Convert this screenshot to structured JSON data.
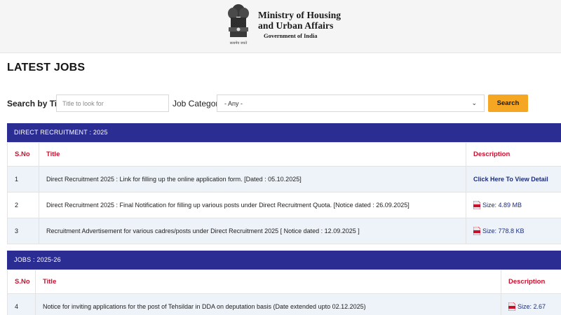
{
  "header": {
    "ministry_line1": "Ministry of Housing",
    "ministry_line2": "and Urban Affairs",
    "government": "Government of India",
    "emblem_caption": "सत्यमेव जयते"
  },
  "page_title": "LATEST JOBS",
  "search": {
    "title_label": "Search by Title",
    "title_placeholder": "Title to look for",
    "category_label": "Job Category",
    "category_value": "- Any -",
    "button_label": "Search"
  },
  "colors": {
    "section_header": "#2b2d93",
    "column_header_text": "#c8102e",
    "search_button": "#f5a623",
    "link": "#1c2d7a"
  },
  "sections": [
    {
      "title": "DIRECT RECRUITMENT : 2025",
      "columns": {
        "sno": "S.No",
        "title": "Title",
        "description": "Description"
      },
      "rows": [
        {
          "sno": "1",
          "title": "Direct Recruitment 2025 : Link for filling up the online application form. [Dated : 05.10.2025]",
          "description": "Click Here To View Detail"
        },
        {
          "sno": "2",
          "title": "Direct Recruitment 2025 : Final Notification for filling up various posts under Direct Recruitment Quota. [Notice dated : 26.09.2025]",
          "description": "Size: 4.89 MB"
        },
        {
          "sno": "3",
          "title": "Recruitment Advertisement for various cadres/posts under Direct Recruitment 2025 [ Notice dated : 12.09.2025 ]",
          "description": "Size: 778.8 KB"
        }
      ]
    },
    {
      "title": "JOBS : 2025-26",
      "columns": {
        "sno": "S.No",
        "title": "Title",
        "description": "Description"
      },
      "rows": [
        {
          "sno": "4",
          "title": "Notice for inviting applications for the post of Tehsildar in DDA on deputation basis (Date extended upto 02.12.2025)",
          "description": "Size: 2.67"
        }
      ]
    }
  ],
  "icons": [
    "national-emblem-icon",
    "chevron-down-icon",
    "pdf-icon"
  ]
}
